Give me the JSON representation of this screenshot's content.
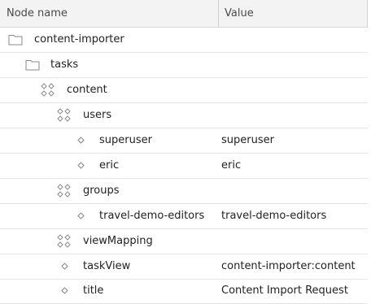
{
  "header": {
    "node_name": "Node name",
    "value": "Value"
  },
  "rows": [
    {
      "name": "content-importer",
      "value": "",
      "icon": "folder-icon",
      "depth": 0
    },
    {
      "name": "tasks",
      "value": "",
      "icon": "folder-icon",
      "depth": 1
    },
    {
      "name": "content",
      "value": "",
      "icon": "content-node-icon",
      "depth": 2
    },
    {
      "name": "users",
      "value": "",
      "icon": "content-node-icon",
      "depth": 3
    },
    {
      "name": "superuser",
      "value": "superuser",
      "icon": "property-icon",
      "depth": 4
    },
    {
      "name": "eric",
      "value": "eric",
      "icon": "property-icon",
      "depth": 4
    },
    {
      "name": "groups",
      "value": "",
      "icon": "content-node-icon",
      "depth": 3
    },
    {
      "name": "travel-demo-editors",
      "value": "travel-demo-editors",
      "icon": "property-icon",
      "depth": 4
    },
    {
      "name": "viewMapping",
      "value": "",
      "icon": "content-node-icon",
      "depth": 3
    },
    {
      "name": "taskView",
      "value": "content-importer:content",
      "icon": "property-icon",
      "depth": 3
    },
    {
      "name": "title",
      "value": "Content Import Request",
      "icon": "property-icon",
      "depth": 3
    }
  ]
}
